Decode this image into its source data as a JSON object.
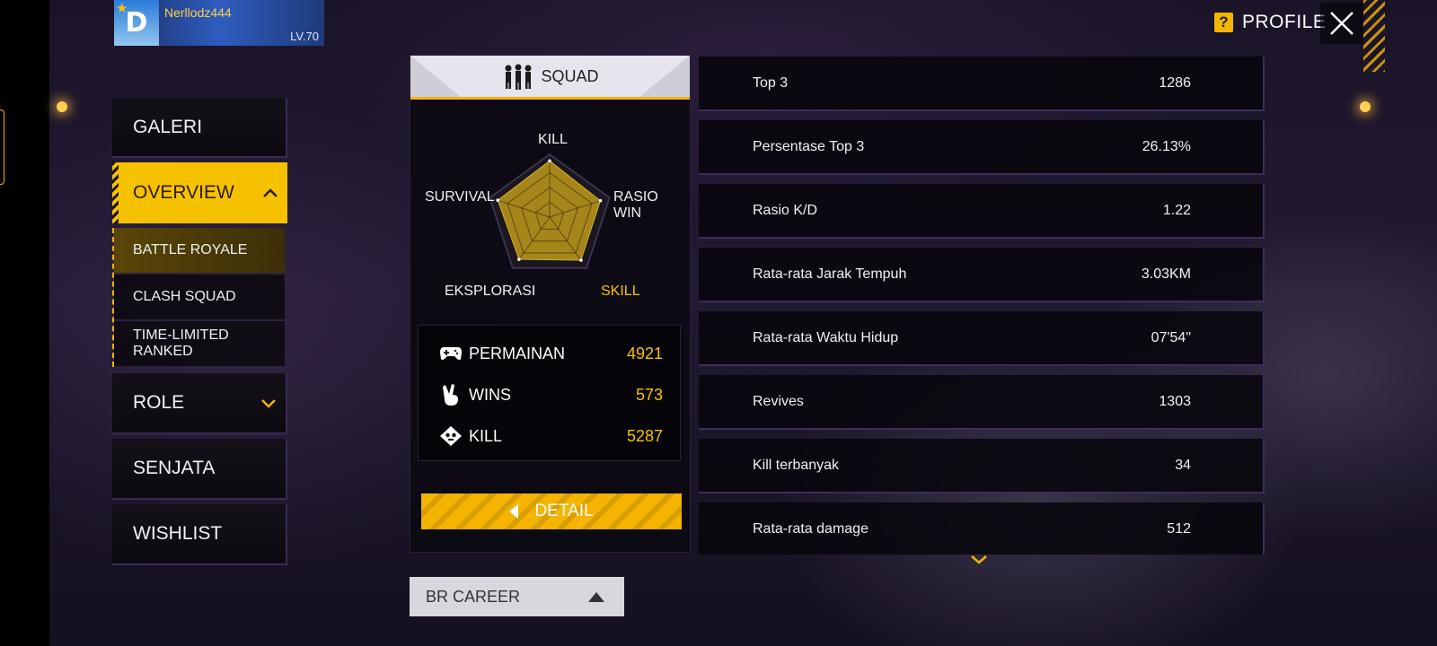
{
  "player": {
    "name": "Nerllodz444",
    "level": "LV.70"
  },
  "header": {
    "profile_label": "PROFILE"
  },
  "nav": {
    "galeri": "GALERI",
    "overview": "OVERVIEW",
    "sub_items": [
      "BATTLE ROYALE",
      "CLASH SQUAD",
      "TIME-LIMITED RANKED"
    ],
    "role": "ROLE",
    "senjata": "SENJATA",
    "wishlist": "WISHLIST"
  },
  "squad": {
    "mode_label": "SQUAD",
    "radar_labels": {
      "top": "KILL",
      "left": "SURVIVAL",
      "right": "RASIO WIN",
      "bottom_left": "EKSPLORASI",
      "bottom_right": "SKILL"
    },
    "radar_values": {
      "kill": 0.95,
      "rasio_win": 0.9,
      "skill": 0.9,
      "eksplorasi": 0.88,
      "survival": 0.92
    },
    "stats": [
      {
        "label": "PERMAINAN",
        "value": "4921",
        "icon": "gamepad-icon"
      },
      {
        "label": "WINS",
        "value": "573",
        "icon": "victory-hand-icon"
      },
      {
        "label": "KILL",
        "value": "5287",
        "icon": "skull-icon"
      }
    ],
    "detail_label": "DETAIL"
  },
  "career_select": {
    "label": "BR CAREER"
  },
  "stat_list": [
    {
      "label": "Top 3",
      "value": "1286"
    },
    {
      "label": "Persentase Top 3",
      "value": "26.13%"
    },
    {
      "label": "Rasio K/D",
      "value": "1.22"
    },
    {
      "label": "Rata-rata Jarak Tempuh",
      "value": "3.03KM"
    },
    {
      "label": "Rata-rata Waktu Hidup",
      "value": "07'54\""
    },
    {
      "label": "Revives",
      "value": "1303"
    },
    {
      "label": "Kill terbanyak",
      "value": "34"
    },
    {
      "label": "Rata-rata damage",
      "value": "512"
    }
  ],
  "colors": {
    "accent": "#f6c200",
    "panel": "#0c0a12",
    "text": "#f0f0f0"
  }
}
